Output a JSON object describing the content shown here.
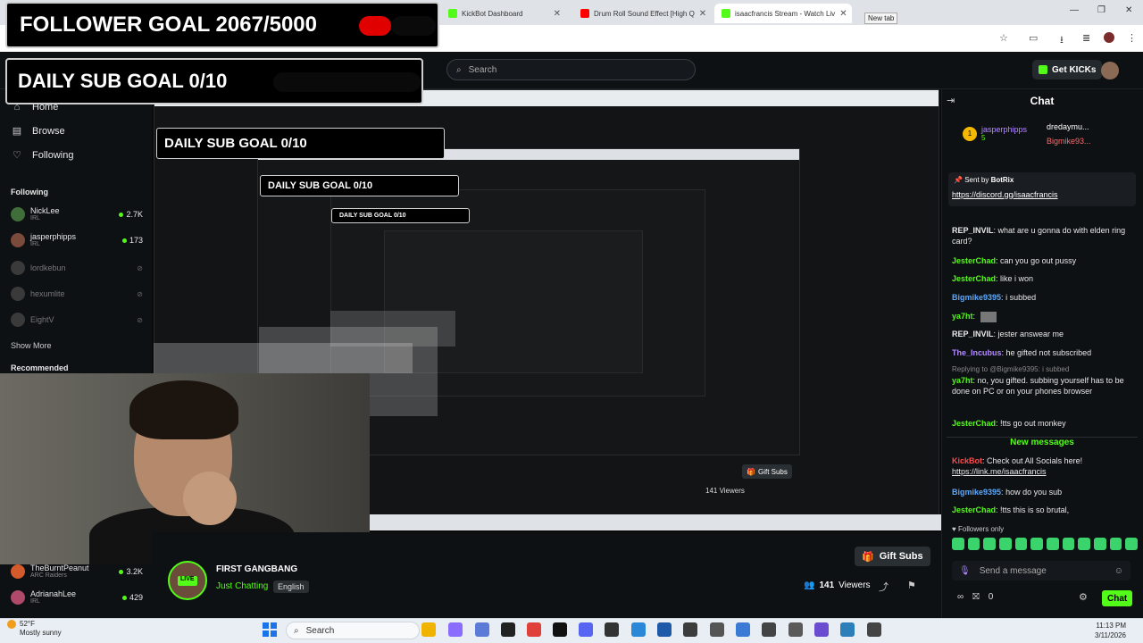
{
  "browser": {
    "tabs": [
      {
        "title": "KickBot Dashboard",
        "favicon_color": "#53fc18"
      },
      {
        "title": "Drum Roll Sound Effect [High Q",
        "favicon_color": "#ff0000"
      },
      {
        "title": "isaacfrancis Stream - Watch Liv",
        "favicon_color": "#53fc18",
        "active": true
      }
    ],
    "new_tab_tooltip": "New tab"
  },
  "overlay": {
    "follower_goal": "FOLLOWER GOAL 2067/5000",
    "sub_goal": "DAILY SUB GOAL 0/10",
    "follower_goal_mini": "FOLLOWER GOAL 2067/5000",
    "sub_goal_mini_1": "DAILY SUB GOAL 0/10",
    "sub_goal_mini_2": "DAILY SUB GOAL 0/10",
    "sub_goal_mini_3": "DAILY SUB GOAL 0/10"
  },
  "header": {
    "search_placeholder": "Search",
    "get_kicks": "Get KICKs"
  },
  "sidebar": {
    "nav": [
      {
        "label": "Home",
        "icon": "home-icon"
      },
      {
        "label": "Browse",
        "icon": "browse-icon"
      },
      {
        "label": "Following",
        "icon": "heart-icon"
      }
    ],
    "following_header": "Following",
    "following": [
      {
        "name": "NickLee",
        "category": "IRL",
        "viewers": "2.7K",
        "live": true,
        "avatar_color": "#3f6e3b"
      },
      {
        "name": "jasperphipps",
        "category": "IRL",
        "viewers": "173",
        "live": true,
        "avatar_color": "#7a4a3a"
      },
      {
        "name": "lordkebun",
        "category": "",
        "viewers": "",
        "live": false,
        "avatar_color": "#3a3a3a"
      },
      {
        "name": "hexumlite",
        "category": "",
        "viewers": "",
        "live": false,
        "avatar_color": "#3a3a3a"
      },
      {
        "name": "EightV",
        "category": "",
        "viewers": "",
        "live": false,
        "avatar_color": "#3a3a3a"
      }
    ],
    "show_more": "Show More",
    "recommended_header": "Recommended",
    "recommended": [
      {
        "name": "TheBurntPeanut",
        "category": "ARC Raiders",
        "viewers": "3.2K",
        "avatar_color": "#d35a2a"
      },
      {
        "name": "AdrianahLee",
        "category": "IRL",
        "viewers": "429",
        "avatar_color": "#b04a6a"
      }
    ]
  },
  "stream": {
    "title": "FIRST GANGBANG",
    "live_badge": "LIVE",
    "category": "Just Chatting",
    "language": "English",
    "viewers": "141",
    "viewers_label": "Viewers",
    "gift_subs": "Gift Subs",
    "mini_gift_subs": "Gift Subs",
    "mini_viewers": "141 Viewers"
  },
  "chat": {
    "title": "Chat",
    "top_gifter": {
      "name": "jasperphipps",
      "count": "5"
    },
    "top_gifter_2": "dredaymu...",
    "top_gifter_3": "Bigmike93...",
    "pinned_label": "Sent by",
    "pinned_sender": "BotRix",
    "pinned_link": "https://discord.gg/isaacfrancis",
    "messages": [
      {
        "user": "REP_INVIL",
        "color": "#e8e8e8",
        "text": "what are u gonna do with elden ring card?"
      },
      {
        "user": "JesterChad",
        "color": "#53fc18",
        "text": "can you go out pussy"
      },
      {
        "user": "JesterChad",
        "color": "#53fc18",
        "text": "like i won"
      },
      {
        "user": "Bigmike9395",
        "color": "#5aa9ff",
        "text": "i subbed"
      },
      {
        "user": "ya7ht",
        "color": "#53fc18",
        "text": ""
      },
      {
        "user": "REP_INVIL",
        "color": "#e8e8e8",
        "text": "jester answear me"
      },
      {
        "user": "The_Incubus",
        "color": "#b38aff",
        "text": "he gifted not subscribed"
      },
      {
        "user": "ya7ht",
        "color": "#53fc18",
        "text": "no, you gifted. subbing yourself has to be done on PC or on your phones browser"
      },
      {
        "user": "JesterChad",
        "color": "#53fc18",
        "text": "!tts go out monkey"
      }
    ],
    "reply_to": "Replying to @Bigmike9395: i subbed",
    "new_messages": "New messages",
    "messages_after": [
      {
        "user": "KickBot",
        "color": "#ff4a4a",
        "text": "Check out All Socials here!",
        "link": "https://link.me/isaacfrancis"
      },
      {
        "user": "Bigmike9395",
        "color": "#5aa9ff",
        "text": "how do you sub"
      },
      {
        "user": "JesterChad",
        "color": "#53fc18",
        "text": "!tts this is so brutal,"
      }
    ],
    "followers_only": "Followers only",
    "send_placeholder": "Send a message",
    "kicks_count": "0",
    "chat_button": "Chat"
  },
  "taskbar": {
    "weather_temp": "52°F",
    "weather_desc": "Mostly sunny",
    "search": "Search",
    "time": "11:13 PM",
    "date": "3/11/2026"
  }
}
